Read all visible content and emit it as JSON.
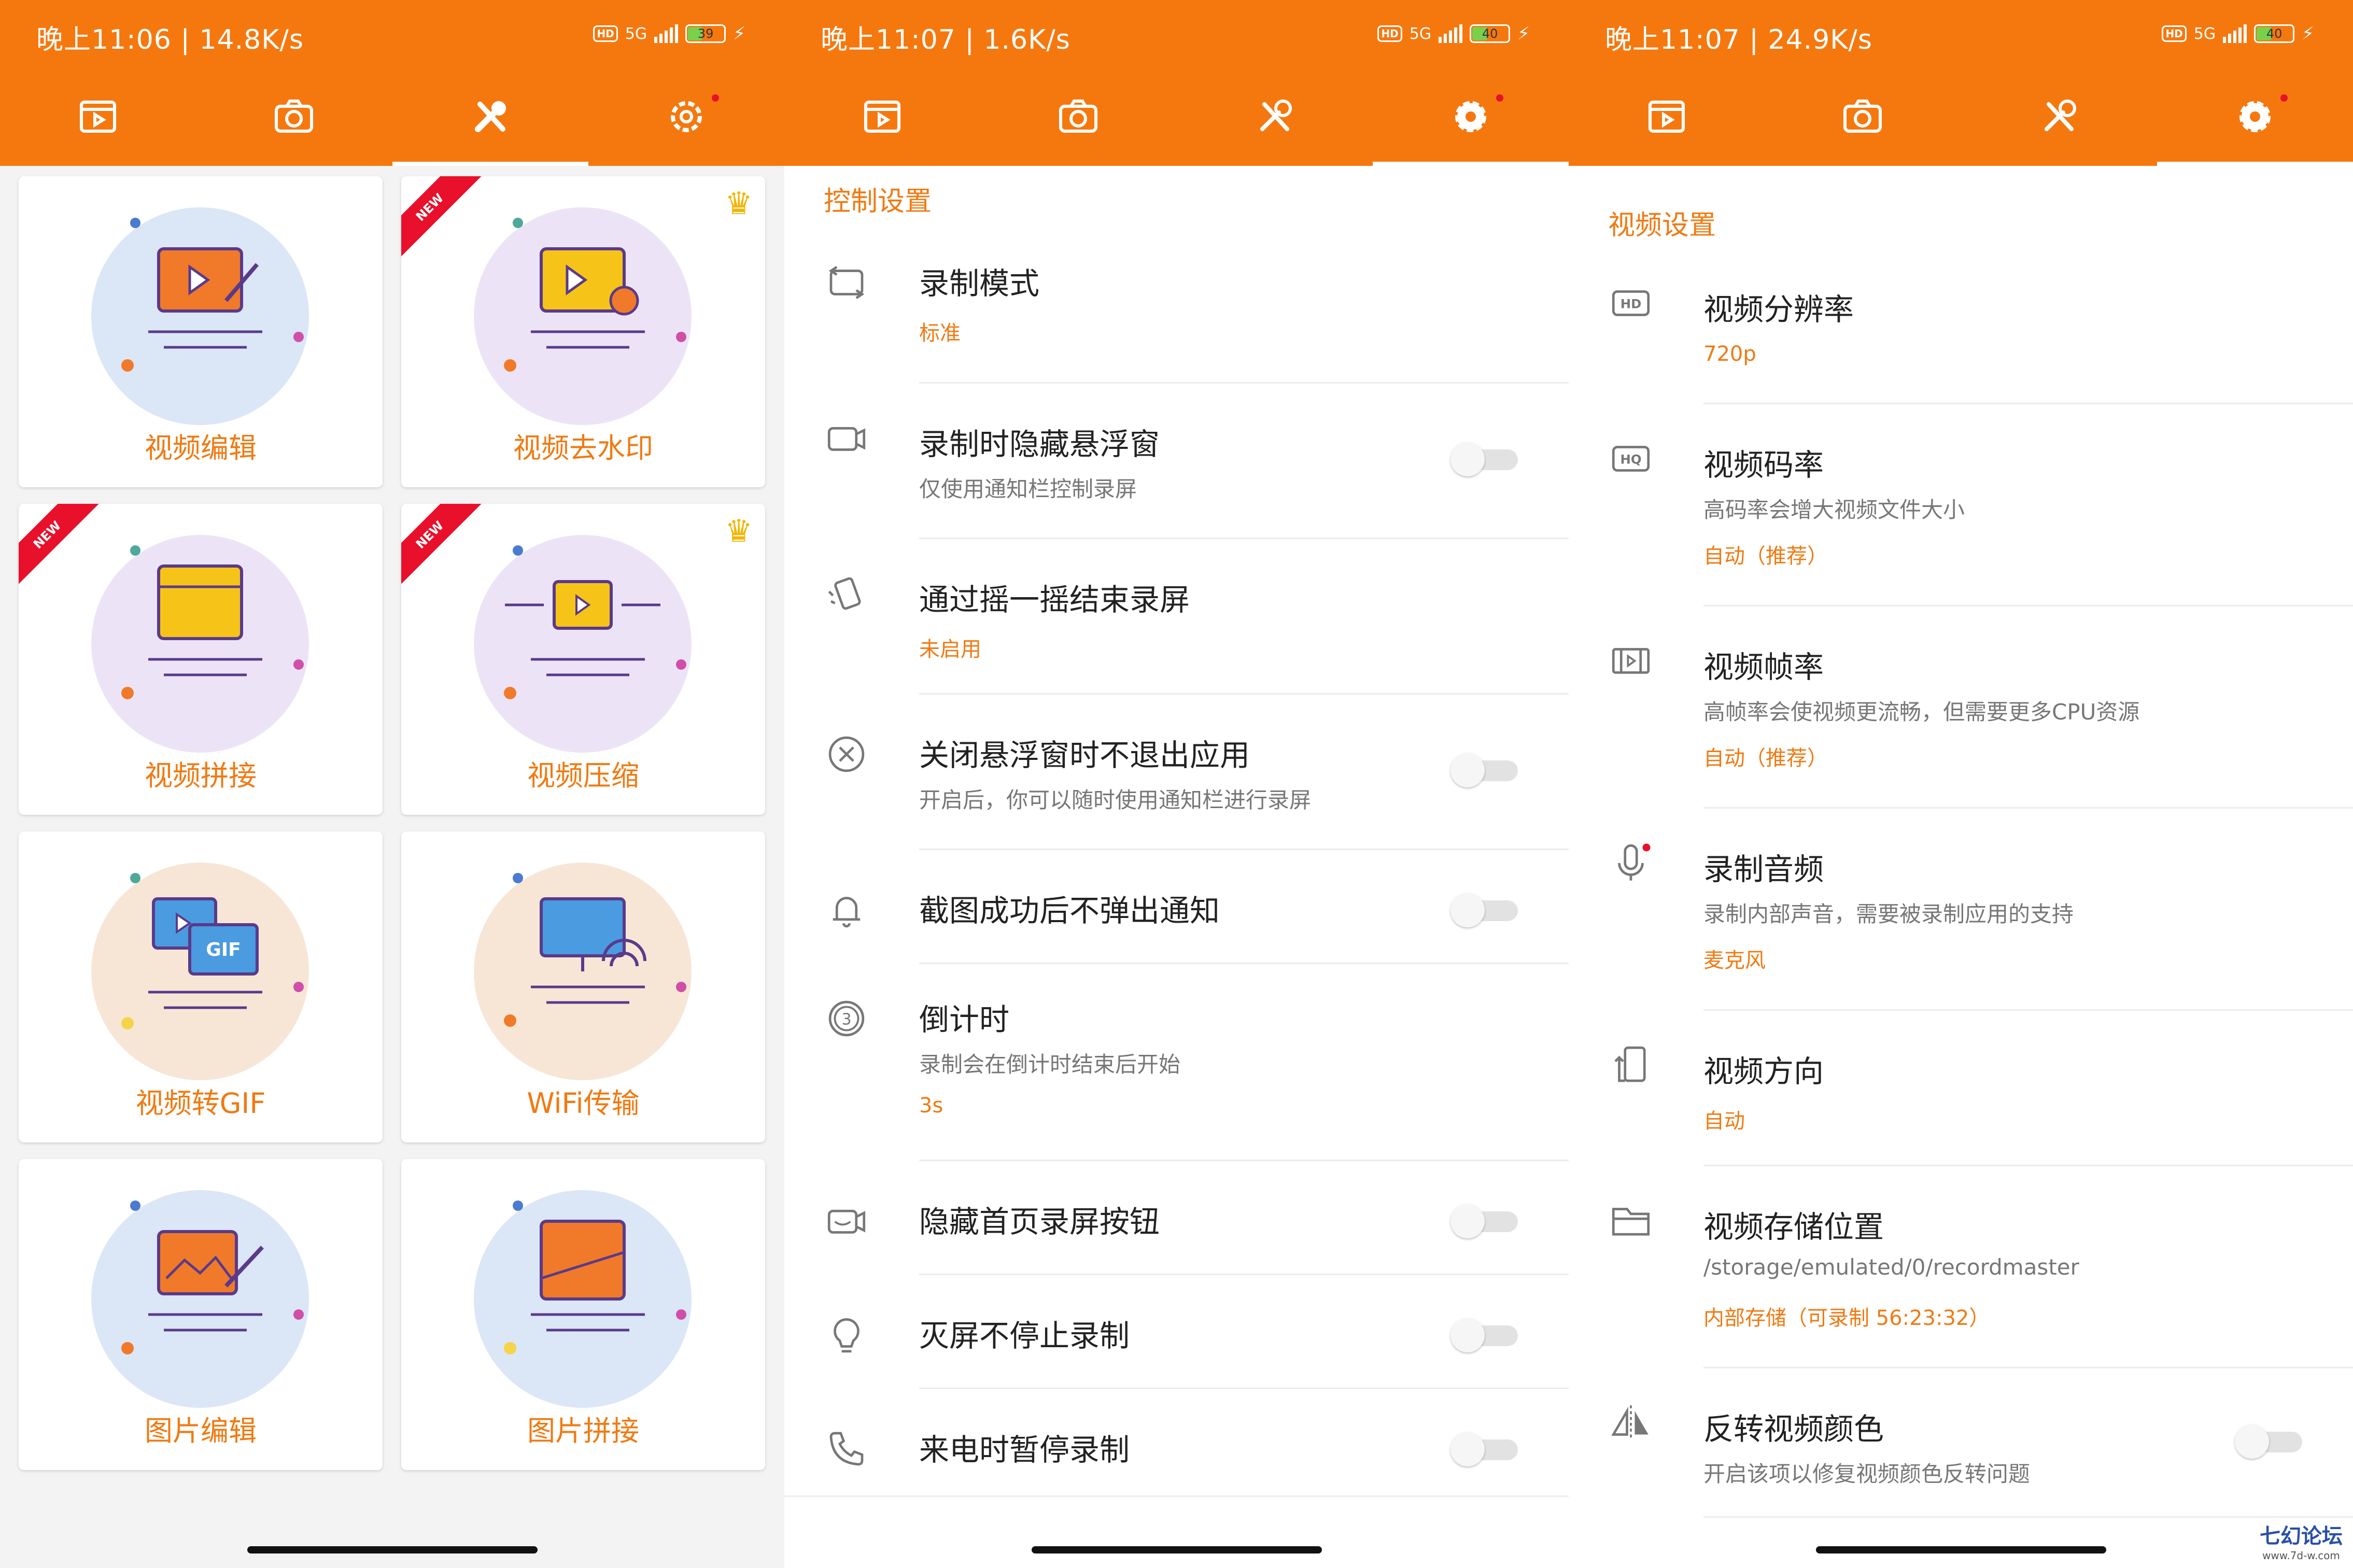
{
  "panels": [
    {
      "status": {
        "time": "晚上11:06 | 14.8K/s",
        "battery": "39",
        "network": "5G"
      },
      "tabs": [
        "video-icon",
        "camera-icon",
        "tools-icon",
        "settings-icon"
      ],
      "active_tab": 2,
      "cards": [
        {
          "label": "视频编辑",
          "new": false,
          "crown": false
        },
        {
          "label": "视频去水印",
          "new": true,
          "crown": true
        },
        {
          "label": "视频拼接",
          "new": true,
          "crown": false
        },
        {
          "label": "视频压缩",
          "new": true,
          "crown": true
        },
        {
          "label": "视频转GIF",
          "new": false,
          "crown": false
        },
        {
          "label": "WiFi传输",
          "new": false,
          "crown": false
        },
        {
          "label": "图片编辑",
          "new": false,
          "crown": false
        },
        {
          "label": "图片拼接",
          "new": false,
          "crown": false
        }
      ],
      "new_badge": "NEW",
      "gif_text": "GIF"
    },
    {
      "status": {
        "time": "晚上11:07 | 1.6K/s",
        "battery": "40",
        "network": "5G"
      },
      "active_tab": 3,
      "section": "控制设置",
      "rows": [
        {
          "icon": "record-mode-icon",
          "title": "录制模式",
          "value": "标准"
        },
        {
          "icon": "camera-outline-icon",
          "title": "录制时隐藏悬浮窗",
          "sub": "仅使用通知栏控制录屏",
          "toggle": false
        },
        {
          "icon": "shake-icon",
          "title": "通过摇一摇结束录屏",
          "value": "未启用"
        },
        {
          "icon": "close-circle-icon",
          "title": "关闭悬浮窗时不退出应用",
          "sub": "开启后，你可以随时使用通知栏进行录屏",
          "toggle": false
        },
        {
          "icon": "bell-icon",
          "title": "截图成功后不弹出通知",
          "toggle": false
        },
        {
          "icon": "countdown-icon",
          "title": "倒计时",
          "sub": "录制会在倒计时结束后开始",
          "value": "3s"
        },
        {
          "icon": "hide-camera-icon",
          "title": "隐藏首页录屏按钮",
          "toggle": false
        },
        {
          "icon": "bulb-icon",
          "title": "灭屏不停止录制",
          "toggle": false
        },
        {
          "icon": "phone-icon",
          "title": "来电时暂停录制",
          "toggle": false
        }
      ]
    },
    {
      "status": {
        "time": "晚上11:07 | 24.9K/s",
        "battery": "40",
        "network": "5G"
      },
      "active_tab": 3,
      "section": "视频设置",
      "rows": [
        {
          "icon": "hd-icon",
          "title": "视频分辨率",
          "value": "720p",
          "badge": "HD"
        },
        {
          "icon": "hq-icon",
          "title": "视频码率",
          "sub": "高码率会增大视频文件大小",
          "value": "自动（推荐）",
          "badge": "HQ"
        },
        {
          "icon": "film-icon",
          "title": "视频帧率",
          "sub": "高帧率会使视频更流畅，但需要更多CPU资源",
          "value": "自动（推荐）"
        },
        {
          "icon": "mic-icon",
          "title": "录制音频",
          "sub": "录制内部声音，需要被录制应用的支持",
          "value": "麦克风"
        },
        {
          "icon": "orientation-icon",
          "title": "视频方向",
          "value": "自动"
        },
        {
          "icon": "folder-icon",
          "title": "视频存储位置",
          "sub": "/storage/emulated/0/recordmaster",
          "value": "内部存储（可录制 56:23:32）"
        },
        {
          "icon": "flip-icon",
          "title": "反转视频颜色",
          "sub": "开启该项以修复视频颜色反转问题",
          "toggle": false
        }
      ],
      "watermark": {
        "title": "七幻论坛",
        "url": "www.7d-w.com"
      }
    }
  ],
  "colors": {
    "accent": "#f5780f",
    "label": "#f07a12",
    "badge": "#e8102b"
  }
}
